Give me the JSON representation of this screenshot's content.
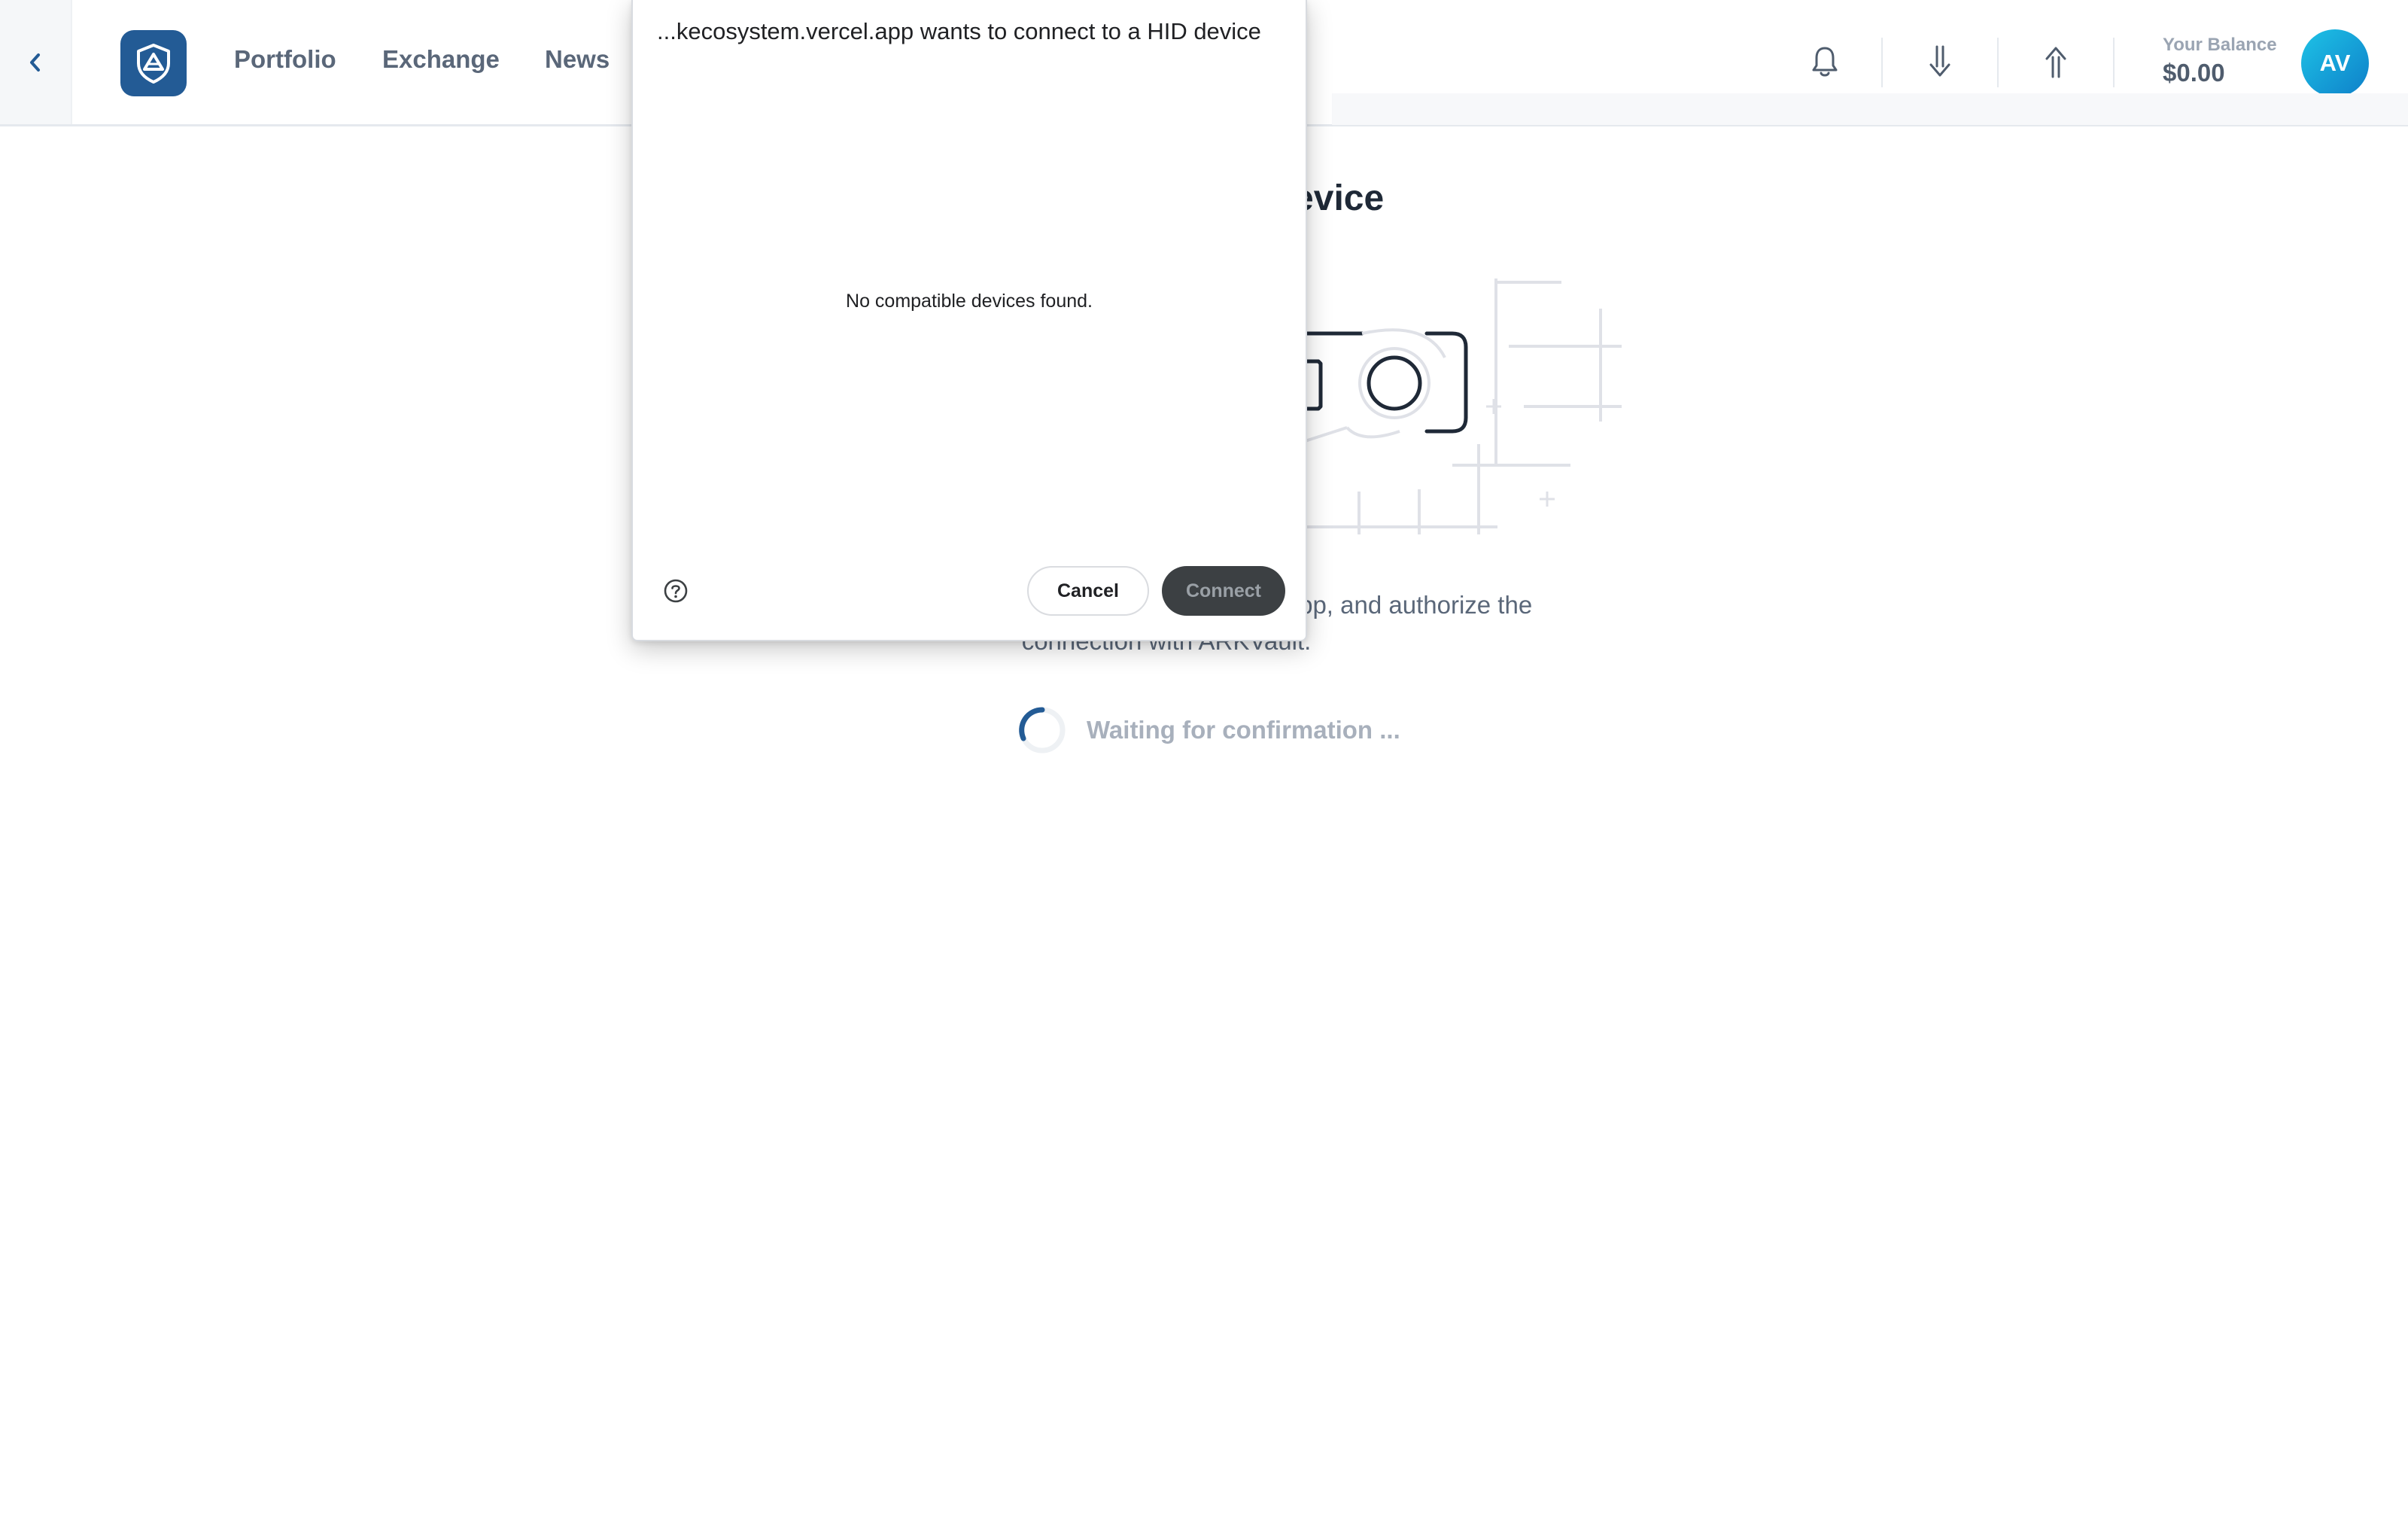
{
  "header": {
    "nav": [
      "Portfolio",
      "Exchange",
      "News"
    ],
    "balance_label": "Your Balance",
    "balance_value": "$0.00",
    "avatar_initials": "AV"
  },
  "main": {
    "heading": "Connect Your Device",
    "description": "Connect your Ledger device, open the ARK app, and authorize the connection with ARKVault.",
    "waiting": "Waiting for confirmation ..."
  },
  "dialog": {
    "title": "...kecosystem.vercel.app wants to connect to a HID device",
    "empty_message": "No compatible devices found.",
    "cancel_label": "Cancel",
    "connect_label": "Connect"
  },
  "icons": {
    "back": "chevron-left-icon",
    "logo": "ark-shield-logo",
    "notifications": "bell-icon",
    "receive": "arrow-down-icon",
    "send": "arrow-up-icon",
    "help": "question-circle-icon"
  },
  "colors": {
    "brand": "#235b95",
    "avatar": "#0e9fd8",
    "connect_button": "#3c4043"
  }
}
